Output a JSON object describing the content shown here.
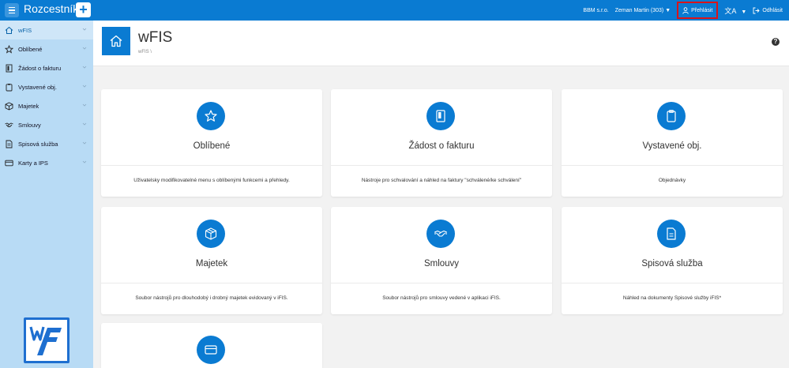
{
  "topbar": {
    "app_title": "Rozcestník",
    "company": "BBM s.r.o.",
    "user": "Zeman Martin (303)",
    "prehled_label": "Přehlásit",
    "logout_label": "Odhlásit",
    "accent_color": "#0a7bd2",
    "highlight_color": "#d9141a"
  },
  "sidebar": {
    "items": [
      {
        "label": "wFIS",
        "icon": "home-icon"
      },
      {
        "label": "Oblíbené",
        "icon": "star-icon"
      },
      {
        "label": "Žádost o fakturu",
        "icon": "invoice-icon"
      },
      {
        "label": "Vystavené obj.",
        "icon": "clipboard-icon"
      },
      {
        "label": "Majetek",
        "icon": "box-icon"
      },
      {
        "label": "Smlouvy",
        "icon": "handshake-icon"
      },
      {
        "label": "Spisová služba",
        "icon": "document-icon"
      },
      {
        "label": "Karty a IPS",
        "icon": "card-icon"
      }
    ]
  },
  "header": {
    "title": "wFIS",
    "breadcrumb": "wFIS  \\"
  },
  "cards": [
    {
      "title": "Oblíbené",
      "desc": "Uživatelsky modifikovatelné menu s oblíbenými funkcemi a přehledy.",
      "icon": "star-icon"
    },
    {
      "title": "Žádost o fakturu",
      "desc": "Nástroje pro schvalování a náhled na faktury \"schválené/ke schválení\"",
      "icon": "invoice-icon"
    },
    {
      "title": "Vystavené obj.",
      "desc": "Objednávky",
      "icon": "clipboard-icon"
    },
    {
      "title": "Majetek",
      "desc": "Soubor nástrojů pro dlouhodobý i drobný majetek evidovaný v iFIS.",
      "icon": "box-icon"
    },
    {
      "title": "Smlouvy",
      "desc": "Soubor nástrojů pro smlouvy vedené v aplikaci iFIS.",
      "icon": "handshake-icon"
    },
    {
      "title": "Spisová služba",
      "desc": "Náhled na dokumenty Spisové služby iFIS*",
      "icon": "document-icon"
    },
    {
      "title": "",
      "desc": "",
      "icon": "card-icon"
    }
  ]
}
